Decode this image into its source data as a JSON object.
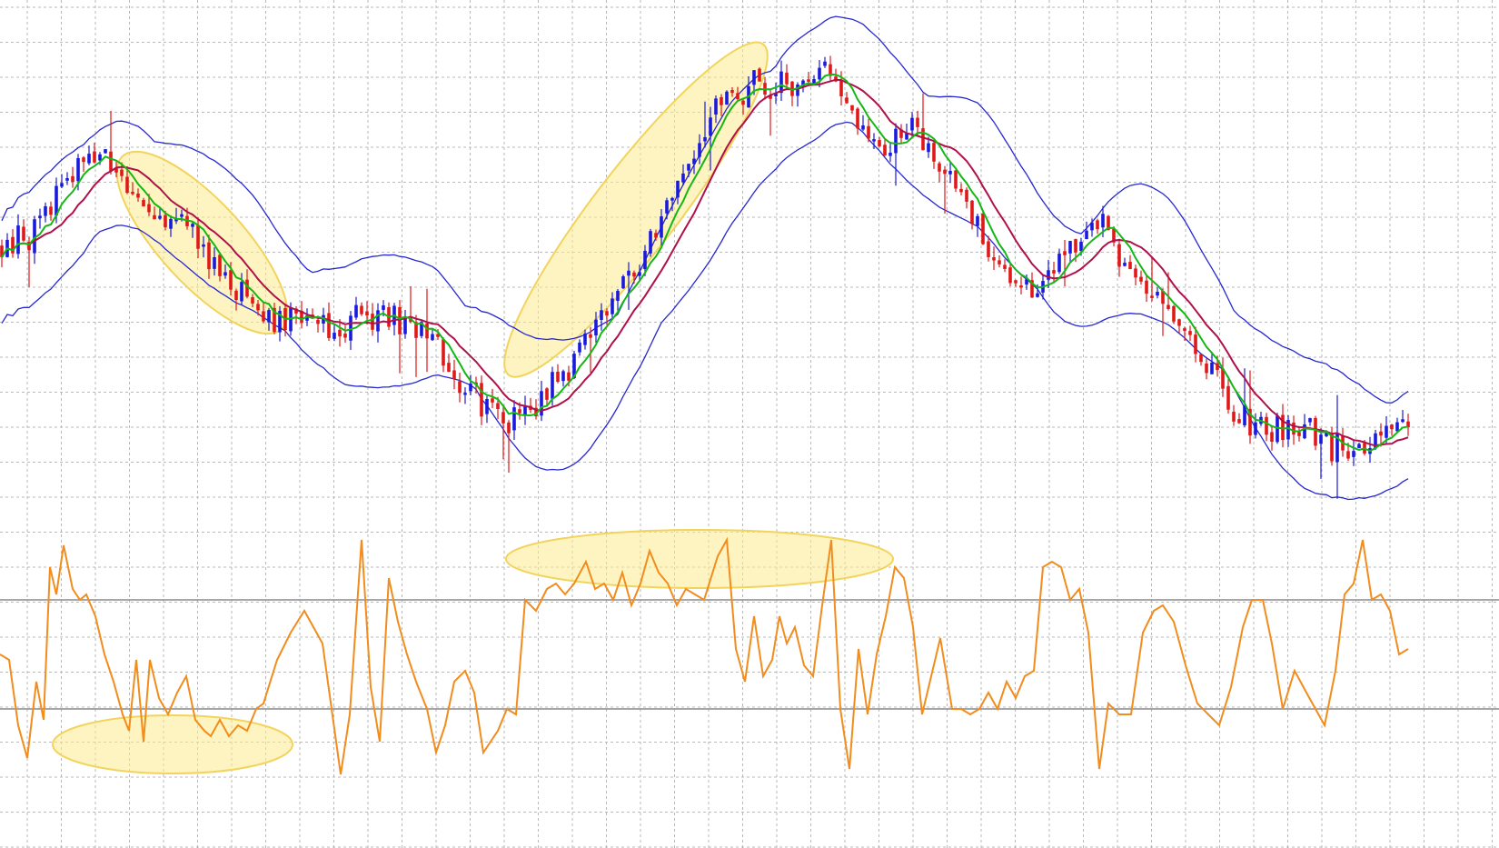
{
  "chart_data": [
    {
      "type": "candlestick",
      "panel": "price",
      "title": "",
      "grid": true,
      "colors": {
        "up_candle": "#1a1adc",
        "down_candle": "#e01818",
        "bollinger_band": "#2727d0",
        "fast_ma": "#14b814",
        "slow_ma": "#b0104a",
        "highlight": "#fbeb8f"
      },
      "ylim": [
        0,
        100
      ],
      "trend_path": [
        [
          0,
          55
        ],
        [
          30,
          56
        ],
        [
          55,
          62
        ],
        [
          90,
          70
        ],
        [
          110,
          72
        ],
        [
          130,
          67
        ],
        [
          160,
          63
        ],
        [
          200,
          58
        ],
        [
          240,
          51
        ],
        [
          270,
          44
        ],
        [
          300,
          40
        ],
        [
          330,
          39
        ],
        [
          370,
          39
        ],
        [
          400,
          41
        ],
        [
          430,
          40
        ],
        [
          460,
          39
        ],
        [
          480,
          34
        ],
        [
          510,
          27
        ],
        [
          540,
          22
        ],
        [
          560,
          20
        ],
        [
          580,
          22
        ],
        [
          620,
          29
        ],
        [
          680,
          44
        ],
        [
          730,
          61
        ],
        [
          770,
          75
        ],
        [
          800,
          84
        ],
        [
          830,
          86
        ],
        [
          860,
          86
        ],
        [
          900,
          88
        ],
        [
          925,
          87
        ],
        [
          950,
          78
        ],
        [
          975,
          74
        ],
        [
          1000,
          80
        ],
        [
          1020,
          72
        ],
        [
          1040,
          70
        ],
        [
          1060,
          66
        ],
        [
          1080,
          57
        ],
        [
          1100,
          49
        ],
        [
          1130,
          45
        ],
        [
          1160,
          49
        ],
        [
          1190,
          57
        ],
        [
          1210,
          60
        ],
        [
          1230,
          52
        ],
        [
          1260,
          45
        ],
        [
          1300,
          40
        ],
        [
          1330,
          31
        ],
        [
          1360,
          21
        ],
        [
          1390,
          18
        ],
        [
          1420,
          19
        ],
        [
          1450,
          16
        ],
        [
          1480,
          14
        ],
        [
          1500,
          14
        ],
        [
          1520,
          18
        ],
        [
          1550,
          20
        ]
      ],
      "band_width": 13,
      "highlights": [
        {
          "from": [
            135,
            72
          ],
          "to": [
            310,
            38
          ]
        },
        {
          "from": [
            560,
            29
          ],
          "to": [
            840,
            94
          ]
        }
      ],
      "series": [
        {
          "key": "price"
        },
        {
          "key": "upper_band"
        },
        {
          "key": "lower_band"
        },
        {
          "key": "fast_ma"
        },
        {
          "key": "slow_ma"
        }
      ]
    },
    {
      "type": "line",
      "panel": "oscillator",
      "title": "",
      "grid": true,
      "colors": {
        "line": "#f28c1c",
        "levels": "#8a8a8a"
      },
      "ylim": [
        0,
        100
      ],
      "levels": [
        70,
        30
      ],
      "highlights": [
        {
          "cx": 190,
          "cy": 17,
          "rx": 132,
          "ry": 16
        },
        {
          "cx": 770,
          "cy": 85,
          "rx": 213,
          "ry": 16
        }
      ],
      "series": [
        {
          "key": "oscillator",
          "x": [
            0,
            10,
            20,
            30,
            40,
            48,
            55,
            62,
            70,
            80,
            88,
            95,
            105,
            115,
            125,
            135,
            142,
            150,
            158,
            165,
            175,
            185,
            195,
            205,
            215,
            225,
            232,
            242,
            252,
            262,
            272,
            282,
            290,
            305,
            320,
            335,
            345,
            355,
            365,
            375,
            385,
            398,
            408,
            418,
            428,
            438,
            448,
            458,
            470,
            480,
            490,
            500,
            512,
            522,
            532,
            548,
            558,
            568,
            578,
            590,
            602,
            612,
            622,
            632,
            645,
            655,
            665,
            675,
            685,
            695,
            705,
            715,
            725,
            735,
            745,
            755,
            765,
            775,
            790,
            800,
            810,
            820,
            830,
            840,
            850,
            858,
            866,
            875,
            885,
            895,
            905,
            915,
            925,
            935,
            945,
            955,
            965,
            975,
            985,
            995,
            1005,
            1015,
            1025,
            1035,
            1048,
            1058,
            1068,
            1078,
            1088,
            1098,
            1108,
            1118,
            1128,
            1138,
            1148,
            1158,
            1168,
            1178,
            1188,
            1198,
            1210,
            1220,
            1232,
            1245,
            1258,
            1270,
            1280,
            1292,
            1305,
            1318,
            1330,
            1342,
            1355,
            1368,
            1378,
            1390,
            1400,
            1412,
            1425,
            1438,
            1448,
            1458,
            1470,
            1480,
            1490,
            1500,
            1510,
            1520,
            1530,
            1540,
            1550
          ],
          "values": [
            50,
            48,
            24,
            12,
            40,
            26,
            82,
            72,
            90,
            74,
            70,
            72,
            64,
            50,
            40,
            28,
            22,
            48,
            18,
            48,
            34,
            28,
            36,
            42,
            26,
            22,
            20,
            26,
            20,
            24,
            22,
            30,
            32,
            48,
            58,
            66,
            60,
            54,
            30,
            6,
            28,
            92,
            38,
            18,
            78,
            62,
            50,
            40,
            30,
            14,
            24,
            40,
            44,
            36,
            14,
            22,
            30,
            28,
            70,
            66,
            74,
            76,
            72,
            76,
            84,
            74,
            76,
            70,
            80,
            68,
            76,
            88,
            80,
            76,
            68,
            74,
            72,
            70,
            86,
            92,
            52,
            40,
            64,
            42,
            48,
            64,
            54,
            60,
            46,
            42,
            68,
            92,
            30,
            8,
            52,
            28,
            50,
            64,
            82,
            78,
            60,
            28,
            42,
            56,
            30,
            30,
            28,
            30,
            36,
            30,
            40,
            34,
            42,
            44,
            82,
            84,
            82,
            70,
            74,
            58,
            8,
            32,
            28,
            28,
            58,
            66,
            68,
            62,
            46,
            32,
            28,
            24,
            38,
            60,
            70,
            70,
            54,
            30,
            44,
            36,
            30,
            24,
            44,
            72,
            76,
            92,
            70,
            72,
            66,
            50,
            52
          ]
        }
      ]
    }
  ]
}
